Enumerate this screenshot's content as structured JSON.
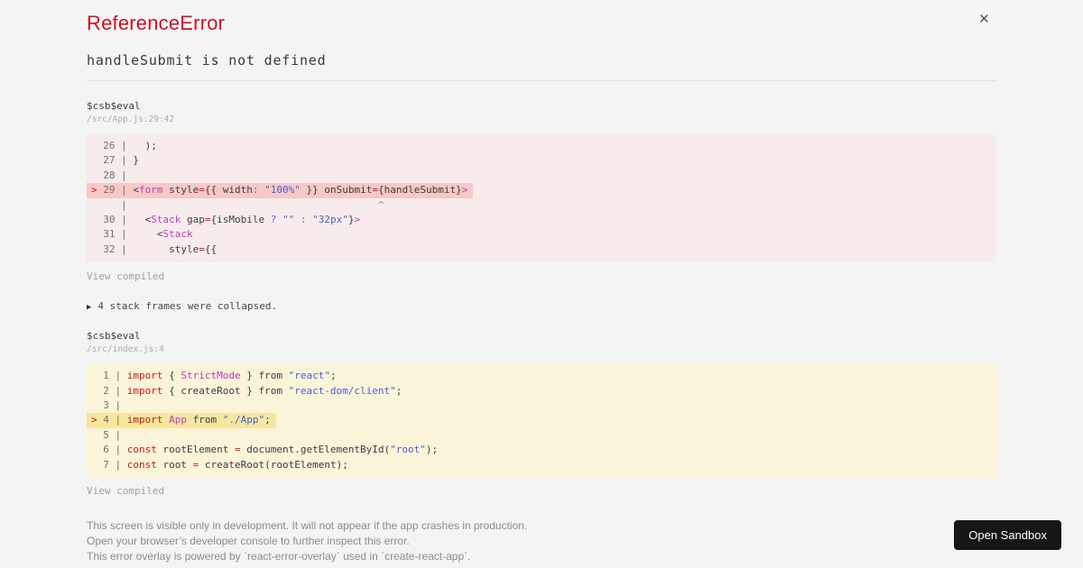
{
  "header": {
    "title": "ReferenceError",
    "subtitle": "handleSubmit is not defined",
    "close_icon": "×"
  },
  "colors": {
    "page_bg": "#f4f4f4",
    "title_red": "#ce1126",
    "keyword_red": "#c41a16",
    "tag_magenta": "#bd3bbd",
    "string_blue": "#4a5fd9",
    "error_block_bg": "#f7eceb",
    "error_line_highlight": "#f6c9c7",
    "warning_block_bg": "#faf4d8",
    "warning_line_highlight": "#f5e79e",
    "button_bg": "#161616"
  },
  "frames": [
    {
      "fn": "$csb$eval",
      "path": "/src/App.js:29:42",
      "variant": "error",
      "view_compiled": "View compiled",
      "lines": [
        {
          "num": "26",
          "marker": " ",
          "hl": false,
          "seg": [
            [
              "p",
              "  );"
            ]
          ]
        },
        {
          "num": "27",
          "marker": " ",
          "hl": false,
          "seg": [
            [
              "p",
              "}"
            ]
          ]
        },
        {
          "num": "28",
          "marker": " ",
          "hl": false,
          "seg": []
        },
        {
          "num": "29",
          "marker": ">",
          "hl": true,
          "seg": [
            [
              "p",
              "<"
            ],
            [
              "m",
              "form"
            ],
            [
              "p",
              " style"
            ],
            [
              "k",
              "="
            ],
            [
              "p",
              "{{ width"
            ],
            [
              "s",
              ":"
            ],
            [
              "p",
              " "
            ],
            [
              "s",
              "\"100%\""
            ],
            [
              "p",
              " }} onSubmit"
            ],
            [
              "k",
              "="
            ],
            [
              "p",
              "{handleSubmit}"
            ],
            [
              "m",
              ">"
            ]
          ]
        },
        {
          "num": "",
          "marker": " ",
          "hl": false,
          "seg": [
            [
              "c",
              "                                         ^"
            ]
          ]
        },
        {
          "num": "30",
          "marker": " ",
          "hl": false,
          "seg": [
            [
              "p",
              "  <"
            ],
            [
              "m",
              "Stack"
            ],
            [
              "p",
              " gap"
            ],
            [
              "k",
              "="
            ],
            [
              "p",
              "{isMobile "
            ],
            [
              "s",
              "?"
            ],
            [
              "p",
              " "
            ],
            [
              "s",
              "\"\""
            ],
            [
              "p",
              " "
            ],
            [
              "s",
              ":"
            ],
            [
              "p",
              " "
            ],
            [
              "s",
              "\"32px\""
            ],
            [
              "p",
              "}"
            ],
            [
              "m",
              ">"
            ]
          ]
        },
        {
          "num": "31",
          "marker": " ",
          "hl": false,
          "seg": [
            [
              "p",
              "    <"
            ],
            [
              "m",
              "Stack"
            ]
          ]
        },
        {
          "num": "32",
          "marker": " ",
          "hl": false,
          "seg": [
            [
              "p",
              "      style"
            ],
            [
              "k",
              "="
            ],
            [
              "p",
              "{{"
            ]
          ]
        }
      ]
    },
    {
      "fn": "$csb$eval",
      "path": "/src/index.js:4",
      "variant": "warning",
      "view_compiled": "View compiled",
      "lines": [
        {
          "num": "1",
          "marker": " ",
          "hl": false,
          "seg": [
            [
              "k",
              "import"
            ],
            [
              "p",
              " { "
            ],
            [
              "m",
              "StrictMode"
            ],
            [
              "p",
              " } from "
            ],
            [
              "s",
              "\"react\""
            ],
            [
              "p",
              ";"
            ]
          ]
        },
        {
          "num": "2",
          "marker": " ",
          "hl": false,
          "seg": [
            [
              "k",
              "import"
            ],
            [
              "p",
              " { createRoot } from "
            ],
            [
              "s",
              "\"react-dom/client\""
            ],
            [
              "p",
              ";"
            ]
          ]
        },
        {
          "num": "3",
          "marker": " ",
          "hl": false,
          "seg": []
        },
        {
          "num": "4",
          "marker": ">",
          "hl": true,
          "seg": [
            [
              "k",
              "import"
            ],
            [
              "p",
              " "
            ],
            [
              "m",
              "App"
            ],
            [
              "p",
              " from "
            ],
            [
              "s",
              "\"./App\""
            ],
            [
              "p",
              ";"
            ]
          ]
        },
        {
          "num": "5",
          "marker": " ",
          "hl": false,
          "seg": []
        },
        {
          "num": "6",
          "marker": " ",
          "hl": false,
          "seg": [
            [
              "k",
              "const"
            ],
            [
              "p",
              " rootElement "
            ],
            [
              "k",
              "="
            ],
            [
              "p",
              " document.getElementById("
            ],
            [
              "s",
              "\"root\""
            ],
            [
              "p",
              ");"
            ]
          ]
        },
        {
          "num": "7",
          "marker": " ",
          "hl": false,
          "seg": [
            [
              "k",
              "const"
            ],
            [
              "p",
              " root "
            ],
            [
              "k",
              "="
            ],
            [
              "p",
              " createRoot(rootElement);"
            ]
          ]
        }
      ]
    }
  ],
  "collapsed": {
    "icon": "▶",
    "label": "4 stack frames were collapsed."
  },
  "footer": {
    "lines": [
      "This screen is visible only in development. It will not appear if the app crashes in production.",
      "Open your browser’s developer console to further inspect this error.",
      "This error overlay is powered by `react-error-overlay` used in `create-react-app`."
    ]
  },
  "open_sandbox": {
    "label": "Open Sandbox"
  }
}
